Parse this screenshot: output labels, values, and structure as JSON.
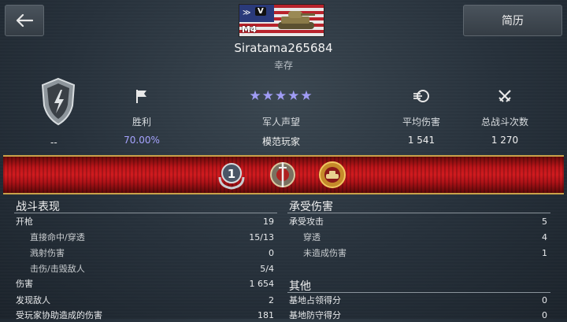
{
  "header": {
    "back_icon": "arrow-left-icon",
    "profile_button": "简历",
    "tank": {
      "name": "M4",
      "tier": "V",
      "flag": "usa-flag"
    },
    "player_name": "Siratama265684",
    "status": "幸存"
  },
  "stats": [
    {
      "icon": "flag-icon",
      "label": "胜利",
      "value": "70.00%"
    },
    {
      "icon": "stars-icon",
      "label": "军人声望",
      "value": "模范玩家",
      "stars": 5
    },
    {
      "icon": "damage-icon",
      "label": "平均伤害",
      "value": "1 541"
    },
    {
      "icon": "crossed-swords-icon",
      "label": "总战斗次数",
      "value": "1 270"
    }
  ],
  "rank_value": "--",
  "colors": {
    "accent": "#a6a3ff",
    "banner": "#c0151a",
    "gold": "#c9a24a"
  },
  "medals": [
    "mastery-1-medal",
    "sword-medal",
    "tank-medal"
  ],
  "battle": {
    "title": "战斗表现",
    "rows": [
      {
        "label": "开枪",
        "value": "19",
        "sub": false
      },
      {
        "label": "直接命中/穿透",
        "value": "15/13",
        "sub": true
      },
      {
        "label": "溅射伤害",
        "value": "0",
        "sub": true
      },
      {
        "label": "击伤/击毁敌人",
        "value": "5/4",
        "sub": true
      },
      {
        "label": "伤害",
        "value": "1 654",
        "sub": false
      },
      {
        "label": "发现敌人",
        "value": "2",
        "sub": false
      },
      {
        "label": "受玩家协助造成的伤害",
        "value": "181",
        "sub": false
      }
    ]
  },
  "received": {
    "title": "承受伤害",
    "rows": [
      {
        "label": "承受攻击",
        "value": "5",
        "sub": false
      },
      {
        "label": "穿透",
        "value": "4",
        "sub": true
      },
      {
        "label": "未造成伤害",
        "value": "1",
        "sub": true
      }
    ]
  },
  "other": {
    "title": "其他",
    "rows": [
      {
        "label": "基地占领得分",
        "value": "0",
        "sub": false
      },
      {
        "label": "基地防守得分",
        "value": "0",
        "sub": false
      }
    ]
  }
}
